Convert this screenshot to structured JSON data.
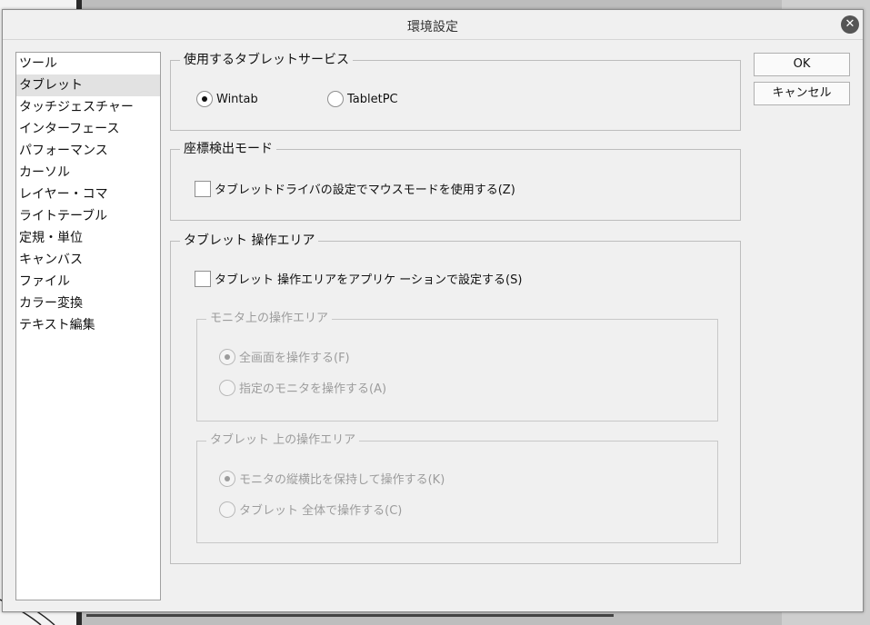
{
  "dialog": {
    "title": "環境設定"
  },
  "categories": [
    {
      "label": "ツール",
      "selected": false
    },
    {
      "label": "タブレット",
      "selected": true
    },
    {
      "label": "タッチジェスチャー",
      "selected": false
    },
    {
      "label": "インターフェース",
      "selected": false
    },
    {
      "label": "パフォーマンス",
      "selected": false
    },
    {
      "label": "カーソル",
      "selected": false
    },
    {
      "label": "レイヤー・コマ",
      "selected": false
    },
    {
      "label": "ライトテーブル",
      "selected": false
    },
    {
      "label": "定規・単位",
      "selected": false
    },
    {
      "label": "キャンバス",
      "selected": false
    },
    {
      "label": "ファイル",
      "selected": false
    },
    {
      "label": "カラー変換",
      "selected": false
    },
    {
      "label": "テキスト編集",
      "selected": false
    }
  ],
  "buttons": {
    "ok": "OK",
    "cancel": "キャンセル"
  },
  "tablet_service": {
    "legend": "使用するタブレットサービス",
    "wintab": "Wintab",
    "tabletpc": "TabletPC",
    "selected": "Wintab"
  },
  "coord_mode": {
    "legend": "座標検出モード",
    "mouse_mode_checkbox": "タブレットドライバの設定でマウスモードを使用する(Z)",
    "mouse_mode_checked": false
  },
  "tablet_area": {
    "legend": "タブレット 操作エリア",
    "app_setting_checkbox": "タブレット 操作エリアをアプリケ ーションで設定する(S)",
    "app_setting_checked": false,
    "monitor_area": {
      "legend": "モニタ上の操作エリア",
      "full_screen": "全画面を操作する(F)",
      "specific_monitor": "指定のモニタを操作する(A)",
      "selected": "full_screen"
    },
    "tablet_surface_area": {
      "legend": "タブレット 上の操作エリア",
      "keep_aspect": "モニタの縦横比を保持して操作する(K)",
      "whole_tablet": "タブレット 全体で操作する(C)",
      "selected": "keep_aspect"
    }
  },
  "colors": {
    "dialog_bg": "#f0f0f0",
    "disabled_text": "#9c9c9c",
    "selected_item_bg": "#e2e2e2"
  }
}
